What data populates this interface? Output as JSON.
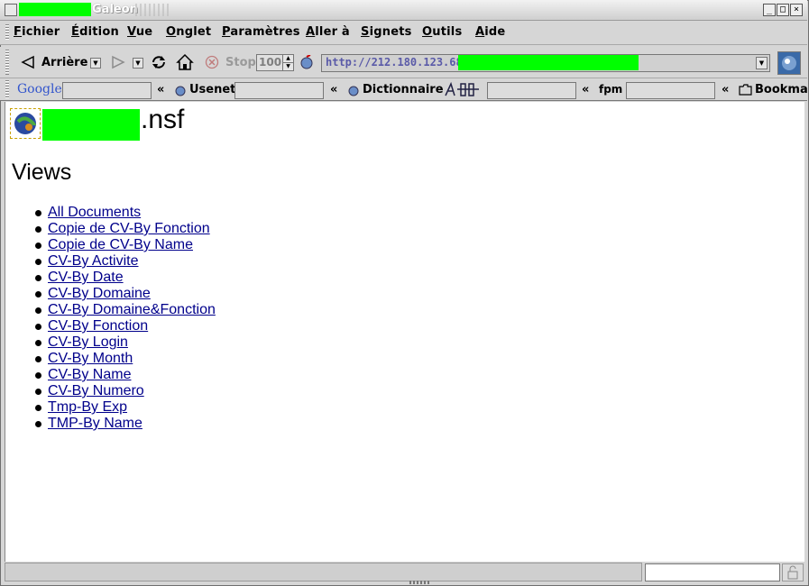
{
  "window": {
    "title": "Galeon",
    "controls": [
      "_",
      "□",
      "×"
    ]
  },
  "menubar": {
    "items": [
      "Fichier",
      "Édition",
      "Vue",
      "Onglet",
      "Paramètres",
      "Aller à",
      "Signets",
      "Outils",
      "Aide"
    ]
  },
  "toolbar": {
    "back_label": "Arrière",
    "stop_label": "Stop",
    "zoom_value": "100",
    "url": "http://212.180.123.68/"
  },
  "bookmarks": {
    "google": "Google",
    "usenet": "Usenet",
    "dictionnaire": "Dictionnaire",
    "fpm": "fpm",
    "bookmarks": "Bookma",
    "chevron": "«"
  },
  "page": {
    "title_suffix": ".nsf",
    "section": "Views",
    "views": [
      "All Documents",
      "Copie de CV-By Fonction",
      "Copie de CV-By Name",
      "CV-By Activite",
      "CV-By Date",
      "CV-By Domaine",
      "CV-By Domaine&Fonction",
      "CV-By Fonction",
      "CV-By Login",
      "CV-By Month",
      "CV-By Name",
      "CV-By Numero",
      "Tmp-By Exp",
      "TMP-By Name"
    ]
  },
  "colors": {
    "redaction": "#00ff00",
    "link": "#00008b",
    "url_text": "#5a5aa8"
  }
}
